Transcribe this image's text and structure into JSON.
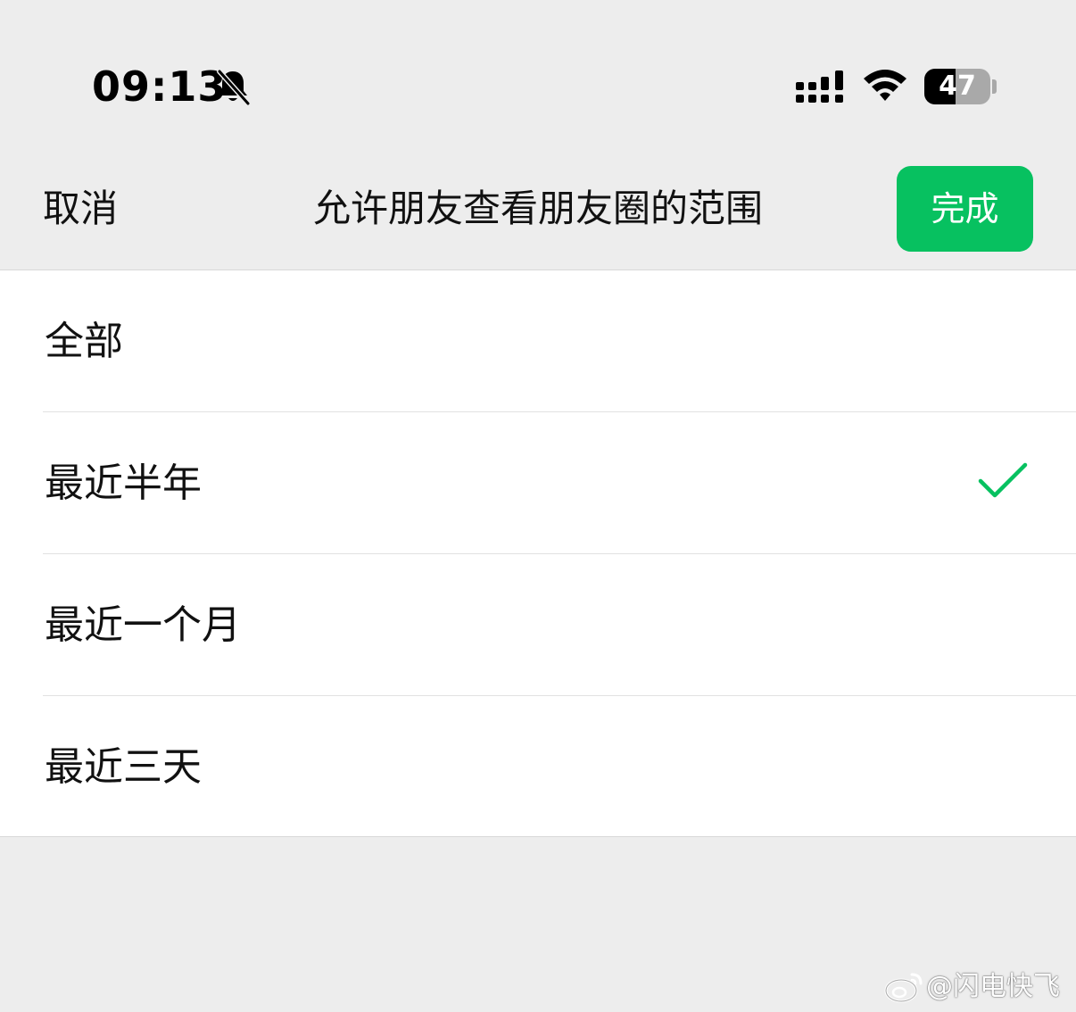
{
  "status_bar": {
    "time": "09:13",
    "icons": [
      "bell-slash-icon",
      "signal-icon",
      "wifi-icon",
      "battery-icon"
    ],
    "battery_level": "47",
    "battery_fraction": 0.47
  },
  "nav": {
    "cancel_label": "取消",
    "title": "允许朋友查看朋友圈的范围",
    "done_label": "完成"
  },
  "options": [
    {
      "label": "全部",
      "selected": false
    },
    {
      "label": "最近半年",
      "selected": true
    },
    {
      "label": "最近一个月",
      "selected": false
    },
    {
      "label": "最近三天",
      "selected": false
    }
  ],
  "watermark": {
    "text": "@闪电快飞",
    "icon": "weibo-icon"
  },
  "colors": {
    "accent_green": "#07c160",
    "page_background": "#ededed",
    "list_background": "#ffffff"
  }
}
